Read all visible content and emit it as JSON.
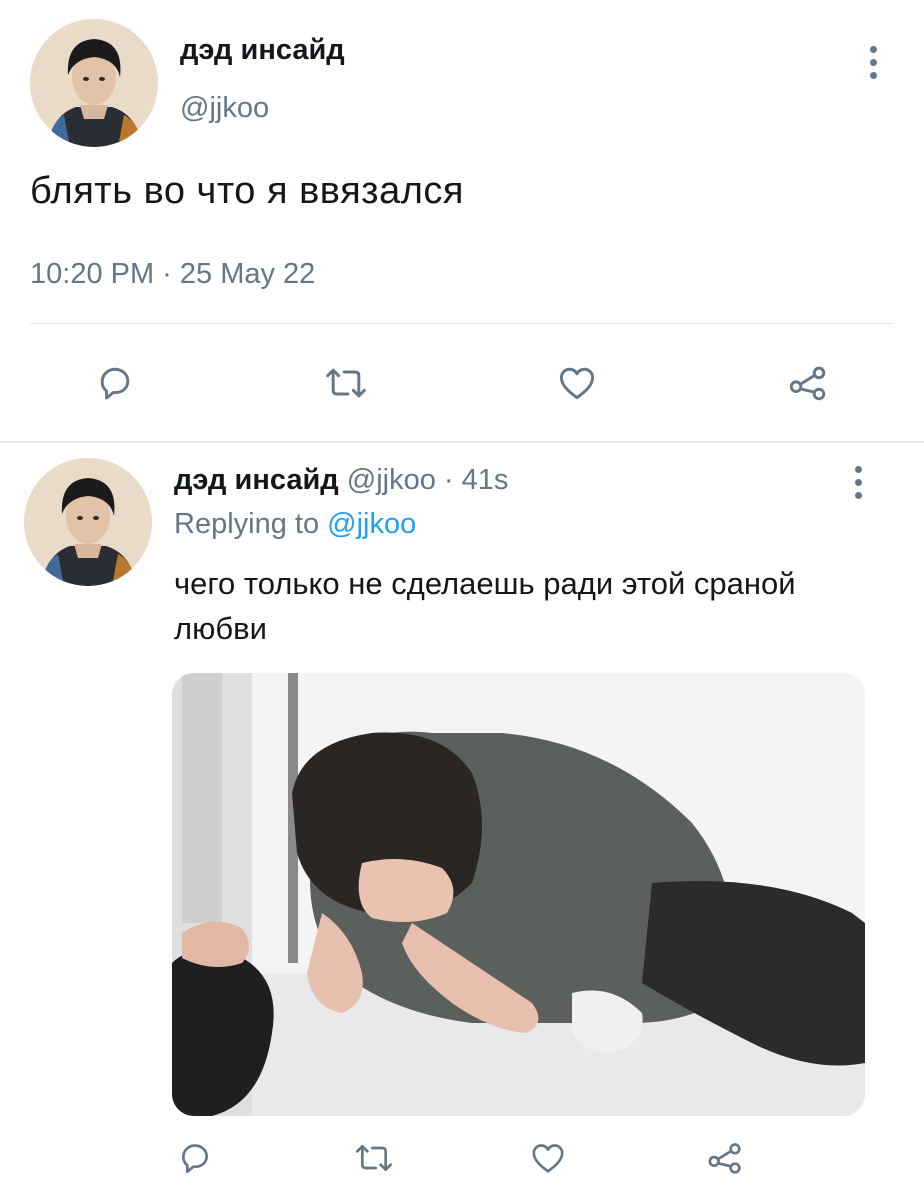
{
  "main_tweet": {
    "author_name": "дэд инсайд",
    "handle": "@jjkoo",
    "text": "блять во что я ввязался",
    "timestamp": "10:20 PM · 25 May 22",
    "avatar_icon": "profile-photo",
    "more_icon": "more-vertical-icon",
    "actions": [
      "reply-icon",
      "retweet-icon",
      "like-icon",
      "share-icon"
    ]
  },
  "reply_tweet": {
    "author_name": "дэд инсайд",
    "handle": "@jjkoo",
    "separator": "·",
    "age": "41s",
    "replying_prefix": "Replying to",
    "replying_to": "@jjkoo",
    "text": "чего только не сделаешь ради этой сраной любви",
    "avatar_icon": "profile-photo",
    "media_description_icon": "attached-photo",
    "actions": [
      "reply-icon",
      "retweet-icon",
      "like-icon",
      "share-icon"
    ]
  },
  "colors": {
    "primary_text": "#14171a",
    "secondary_text": "#657786",
    "link": "#1da1f2",
    "divider": "#e1e8ed"
  }
}
